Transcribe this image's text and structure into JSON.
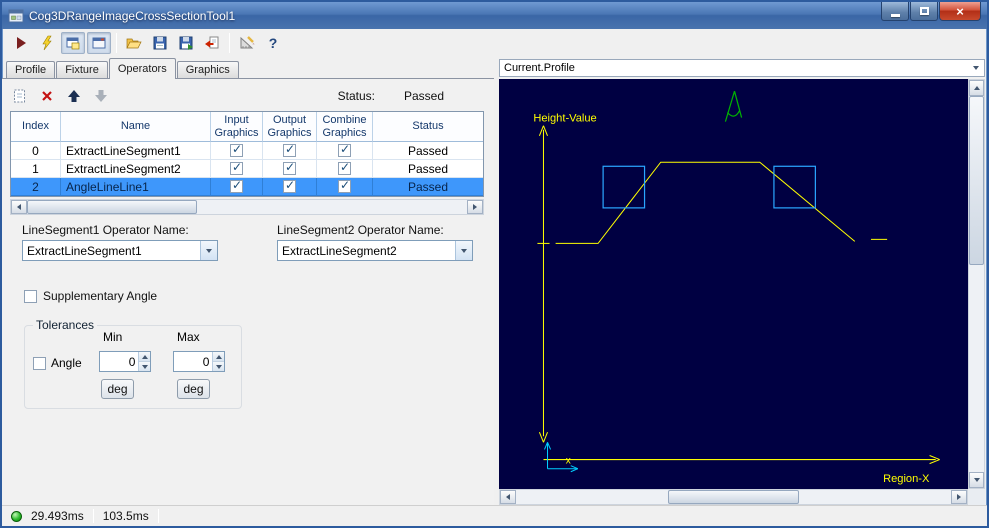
{
  "window": {
    "title": "Cog3DRangeImageCrossSectionTool1"
  },
  "main_toolbar": {
    "icons": [
      "run",
      "live-run",
      "show-tooltips",
      "float-window",
      "open",
      "save",
      "save-record",
      "import",
      "setup",
      "help"
    ]
  },
  "tabs": [
    {
      "label": "Profile",
      "active": false
    },
    {
      "label": "Fixture",
      "active": false
    },
    {
      "label": "Operators",
      "active": true
    },
    {
      "label": "Graphics",
      "active": false
    }
  ],
  "operators_tab": {
    "toolbar": {
      "icons": [
        "add-operator",
        "delete-operator",
        "move-up",
        "move-down"
      ],
      "status_label": "Status:",
      "status_value": "Passed"
    },
    "table": {
      "columns": [
        "Index",
        "Name",
        "Input Graphics",
        "Output Graphics",
        "Combine Graphics",
        "Status"
      ],
      "rows": [
        {
          "index": "0",
          "name": "ExtractLineSegment1",
          "input_graphics": true,
          "output_graphics": true,
          "combine_graphics": true,
          "status": "Passed",
          "selected": false
        },
        {
          "index": "1",
          "name": "ExtractLineSegment2",
          "input_graphics": true,
          "output_graphics": true,
          "combine_graphics": true,
          "status": "Passed",
          "selected": false
        },
        {
          "index": "2",
          "name": "AngleLineLine1",
          "input_graphics": true,
          "output_graphics": true,
          "combine_graphics": true,
          "status": "Passed",
          "selected": true
        }
      ]
    },
    "line_segment1": {
      "label": "LineSegment1 Operator Name:",
      "value": "ExtractLineSegment1"
    },
    "line_segment2": {
      "label": "LineSegment2 Operator Name:",
      "value": "ExtractLineSegment2"
    },
    "supplementary_angle": {
      "label": "Supplementary Angle",
      "checked": false
    },
    "tolerances": {
      "title": "Tolerances",
      "min_label": "Min",
      "max_label": "Max",
      "angle": {
        "label": "Angle",
        "checked": false,
        "min": "0",
        "max": "0",
        "min_unit": "deg",
        "max_unit": "deg"
      }
    }
  },
  "profile_panel": {
    "selector_value": "Current.Profile",
    "y_axis_label": "Height-Value",
    "x_axis_label": "Region-X",
    "origin_label": "x",
    "colors": {
      "background": "#000042",
      "profile": "#ffff00",
      "segment_boxes": "#2aa6ff",
      "angle_marker": "#00b400",
      "origin_frame": "#00cfff"
    }
  },
  "status_bar": {
    "run_time": "29.493ms",
    "total_time": "103.5ms"
  }
}
